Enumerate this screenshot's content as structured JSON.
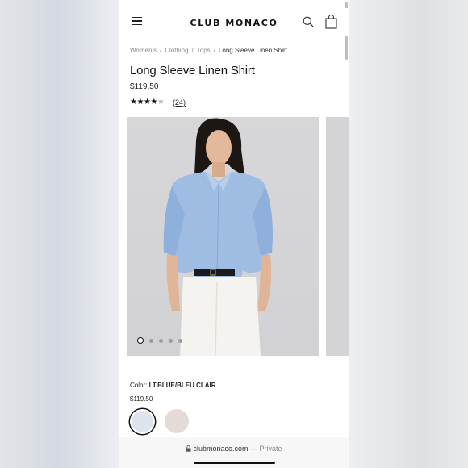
{
  "header": {
    "brand": "CLUB MONACO",
    "menu_icon": "hamburger-icon",
    "search_icon": "search-icon",
    "bag_icon": "shopping-bag-icon"
  },
  "breadcrumb": {
    "items": [
      "Women's",
      "Clothing",
      "Tops"
    ],
    "current": "Long Sleeve Linen Shirt",
    "separator": "/"
  },
  "product": {
    "title": "Long Sleeve Linen Shirt",
    "price": "$119.50",
    "rating": 4,
    "rating_max": 5,
    "reviews": "(24)",
    "image_count": 5,
    "active_image_index": 0,
    "color_label": "Color:",
    "color_value": "LT.BLUE/BLEU CLAIR",
    "swatch_price": "$119.50",
    "swatches": [
      {
        "color": "#dde4ee",
        "selected": true
      },
      {
        "color": "#e4dbd6",
        "selected": false
      }
    ]
  },
  "browser": {
    "url": "clubmonaco.com",
    "mode": "— Private",
    "lock_icon": "lock-icon"
  }
}
